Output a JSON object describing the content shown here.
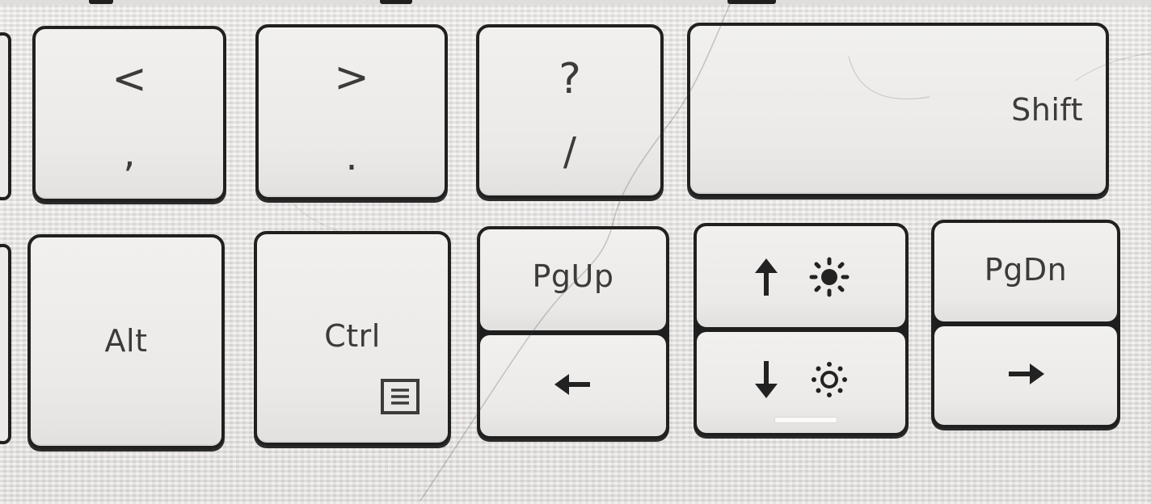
{
  "keyboard": {
    "row1": {
      "comma_key": {
        "shift_legend": "<",
        "legend": ","
      },
      "period_key": {
        "shift_legend": ">",
        "legend": "."
      },
      "slash_key": {
        "shift_legend": "?",
        "legend": "/"
      },
      "shift_key": {
        "legend": "Shift"
      }
    },
    "row2": {
      "alt_key": {
        "legend": "Alt"
      },
      "ctrl_key": {
        "legend": "Ctrl",
        "icon": "menu-icon"
      },
      "pgup_key": {
        "top_legend": "PgUp",
        "bottom_icon": "left-arrow-icon"
      },
      "brightness_key": {
        "top_icons": [
          "up-arrow-icon",
          "brightness-up-icon"
        ],
        "bottom_icons": [
          "down-arrow-icon",
          "brightness-down-icon"
        ]
      },
      "pgdn_key": {
        "top_legend": "PgDn",
        "bottom_icon": "right-arrow-icon"
      }
    }
  },
  "colors": {
    "keycap": "#eeedeb",
    "outline": "#202020",
    "legend": "#3b3b3b"
  }
}
